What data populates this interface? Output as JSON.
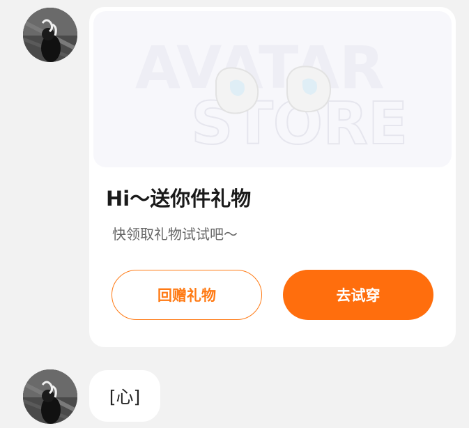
{
  "messages": [
    {
      "type": "gift_card",
      "avatar": "user-avatar",
      "banner": {
        "watermark_line1": "AVATAR",
        "watermark_line2": "STORE",
        "item": "earring-pair"
      },
      "title": "Hi～送你件礼物",
      "subtitle": "快领取礼物试试吧～",
      "buttons": {
        "return_gift": "回赠礼物",
        "try_on": "去试穿"
      }
    },
    {
      "type": "text",
      "avatar": "user-avatar",
      "text": "[心]"
    }
  ],
  "colors": {
    "accent": "#ff6e0d",
    "background": "#f2f2f2",
    "card": "#ffffff"
  }
}
